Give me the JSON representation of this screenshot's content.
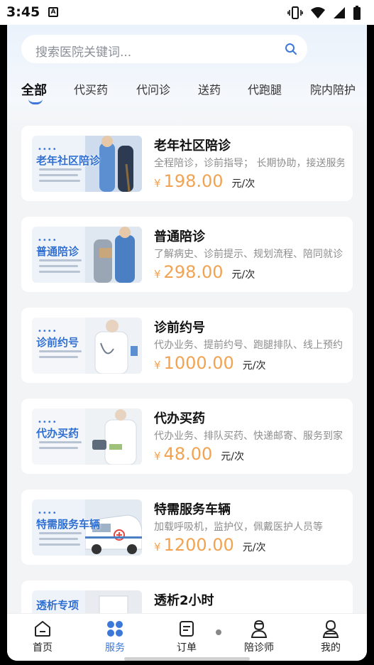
{
  "status_bar": {
    "time": "3:45",
    "sim_badge": "A"
  },
  "search": {
    "placeholder": "搜索医院关键词..."
  },
  "tabs": [
    {
      "label": "全部",
      "active": true
    },
    {
      "label": "代买药"
    },
    {
      "label": "代问诊"
    },
    {
      "label": "送药"
    },
    {
      "label": "代跑腿"
    },
    {
      "label": "院内陪护"
    }
  ],
  "currency_symbol": "¥",
  "services": [
    {
      "thumb_title": "老年社区陪诊",
      "title": "老年社区陪诊",
      "desc": "全程陪诊，诊前指导； 长期协助，接送服务",
      "price": "198.00",
      "unit": "元/次"
    },
    {
      "thumb_title": "普通陪诊",
      "title": "普通陪诊",
      "desc": "了解病史、诊前提示、规划流程、陪同就诊",
      "price": "298.00",
      "unit": "元/次"
    },
    {
      "thumb_title": "诊前约号",
      "title": "诊前约号",
      "desc": "代办业务、提前约号、跑腿排队、线上预约",
      "price": "1000.00",
      "unit": "元/次"
    },
    {
      "thumb_title": "代办买药",
      "title": "代办买药",
      "desc": "代办业务、排队买药、快递邮寄、服务到家",
      "price": "48.00",
      "unit": "元/次"
    },
    {
      "thumb_title": "特需服务车辆",
      "title": "特需服务车辆",
      "desc": "加载呼吸机，监护仪，佩戴医护人员等",
      "price": "1200.00",
      "unit": "元/次"
    },
    {
      "thumb_title": "透析专项",
      "title": "透析2小时",
      "desc": "",
      "price": "",
      "unit": ""
    }
  ],
  "bottom_nav": [
    {
      "label": "首页",
      "icon": "home-icon"
    },
    {
      "label": "服务",
      "icon": "grid-icon",
      "active": true
    },
    {
      "label": "订单",
      "icon": "order-icon"
    },
    {
      "label": "陪诊师",
      "icon": "escort-icon"
    },
    {
      "label": "我的",
      "icon": "profile-icon"
    }
  ],
  "colors": {
    "accent": "#3b78d9",
    "price": "#f2a352",
    "background": "#f3f4f6"
  }
}
